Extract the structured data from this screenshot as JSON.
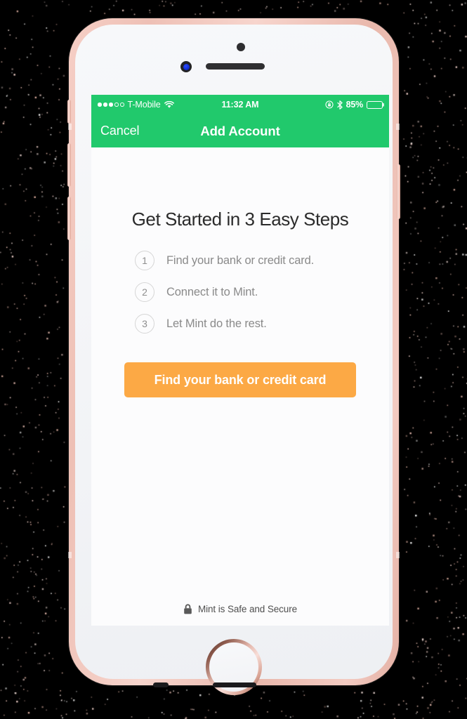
{
  "device": {
    "name": "iphone-rose-gold",
    "frame_color": "#f2cbc1",
    "screen_bg": "#fcfcfd"
  },
  "status_bar": {
    "signal_dots_filled": 3,
    "signal_dots_total": 5,
    "carrier": "T-Mobile",
    "wifi_icon": "wifi-icon",
    "time": "11:32 AM",
    "rotation_lock_icon": "rotation-lock-icon",
    "bluetooth_icon": "bluetooth-icon",
    "battery_percent": "85%",
    "battery_level": 85,
    "accent_color": "#21c96c"
  },
  "nav_bar": {
    "cancel_label": "Cancel",
    "title": "Add Account",
    "background": "#21c96c"
  },
  "content": {
    "heading": "Get Started in 3 Easy Steps",
    "steps": [
      {
        "number": "1",
        "text": "Find your bank or credit card."
      },
      {
        "number": "2",
        "text": "Connect it to Mint."
      },
      {
        "number": "3",
        "text": "Let Mint do the rest."
      }
    ],
    "cta_label": "Find your bank or credit card",
    "cta_color": "#fca945"
  },
  "footer": {
    "lock_icon": "lock-icon",
    "secure_text": "Mint is Safe and Secure"
  }
}
